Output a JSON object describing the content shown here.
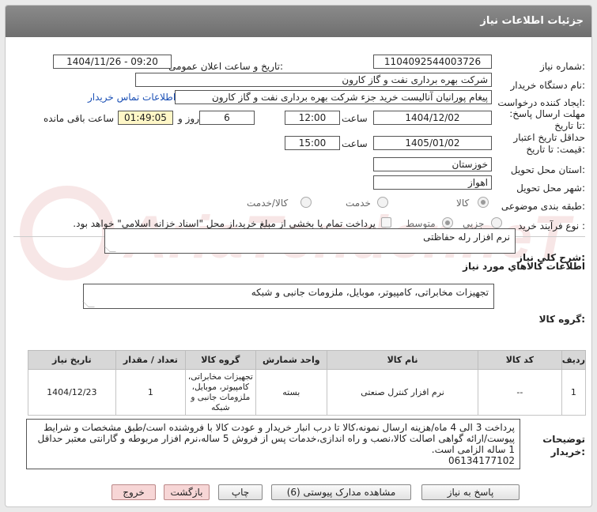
{
  "header": {
    "title": "جزئیات اطلاعات نیاز"
  },
  "watermark": {
    "text": "AriaTender.neT"
  },
  "fields": {
    "need_number_label": "شماره نیاز:",
    "need_number": "1104092544003726",
    "announce_label": "تاریخ و ساعت اعلان عمومی:",
    "announce_value": "1404/11/26 - 09:20",
    "buyer_org_label": "نام دستگاه خریدار:",
    "buyer_org": "شرکت بهره برداری نفت و گاز کارون",
    "requester_label": "ایجاد کننده درخواست:",
    "requester": "پیغام پورانیان آنالیست خرید جزء شرکت بهره برداری نفت و گاز کارون",
    "contact_link": "اطلاعات تماس خریدار",
    "reply_deadline_label": "مهلت ارسال پاسخ: تا تاریخ:",
    "reply_date": "1404/12/02",
    "time_word": "ساعت",
    "reply_time": "12:00",
    "days": "6",
    "days_and": "روز و",
    "remaining_time": "01:49:05",
    "remaining_label": "ساعت باقی مانده",
    "validity_label": "حداقل تاریخ اعتبار قیمت: تا تاریخ:",
    "validity_date": "1405/01/02",
    "validity_time": "15:00",
    "province_label": "استان محل تحویل:",
    "province": "خوزستان",
    "city_label": "شهر محل تحویل:",
    "city": "اهواز",
    "category_label": "طبقه بندی موضوعی:",
    "category_options": [
      "کالا",
      "خدمت",
      "کالا/خدمت"
    ],
    "purchase_type_label": "نوع فرآیند خرید :",
    "purchase_options": [
      "جزیی",
      "متوسط"
    ],
    "payment_note": "پرداخت تمام یا بخشی از مبلغ خرید،از محل \"اسناد خزانه اسلامی\" خواهد بود."
  },
  "description": {
    "label": "شرح کلي نياز:",
    "text": "نرم افزار رله حفاظتی"
  },
  "goods_info": {
    "heading": "اطلاعات كالاهاي مورد نياز",
    "group_label": "گروه کالا:",
    "group_value": "تجهیزات مخابراتی، کامپیوتر، موبایل، ملزومات جانبی و شبکه"
  },
  "table": {
    "headers": [
      "ردیف",
      "کد کالا",
      "نام کالا",
      "واحد شمارش",
      "گروه کالا",
      "تعداد / مقدار",
      "تاریخ نیاز"
    ],
    "rows": [
      [
        "1",
        "--",
        "نرم افزار کنترل صنعتی",
        "بسته",
        "تجهیزات مخابراتی، کامپیوتر، موبایل، ملزومات جانبی و شبکه",
        "1",
        "1404/12/23"
      ]
    ]
  },
  "buyer_notes": {
    "label": "توضیحات خریدار:",
    "text": "پرداخت 3 الی 4 ماه/هزینه ارسال نمونه،کالا تا درب انبار خریدار و عودت کالا با فروشنده است/طبق مشخصات و شرایط پیوست/ارائه گواهی اصالت کالا،نصب و راه اندازی،خدمات پس از فروش 5 ساله،نرم افزار مربوطه و گارانتی معتبر حداقل 1 ساله الزامی است.\n06134177102"
  },
  "buttons": {
    "reply": "پاسخ به نیاز",
    "attachments": "مشاهده مدارک پیوستی (6)",
    "print": "چاپ",
    "back": "بازگشت",
    "exit": "خروج"
  }
}
